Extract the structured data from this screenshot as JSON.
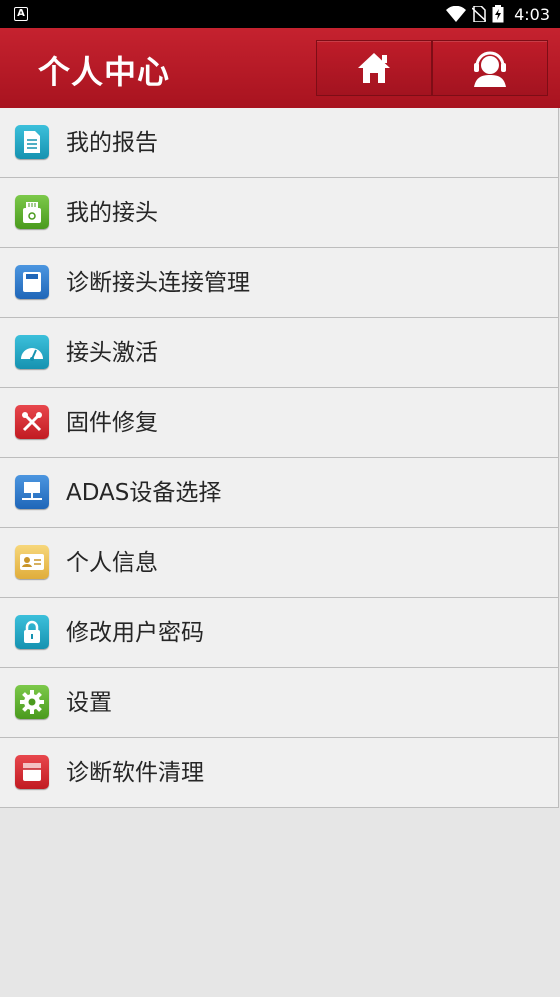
{
  "status_bar": {
    "time": "4:03",
    "app_icon_letter": "A"
  },
  "header": {
    "title": "个人中心"
  },
  "menu": [
    {
      "label": "我的报告",
      "color": "#1aa5c2"
    },
    {
      "label": "我的接头",
      "color": "#5bb12a"
    },
    {
      "label": "诊断接头连接管理",
      "color": "#2c7bd0"
    },
    {
      "label": "接头激活",
      "color": "#1aa5c2"
    },
    {
      "label": "固件修复",
      "color": "#d9262e"
    },
    {
      "label": "ADAS设备选择",
      "color": "#2c7bd0"
    },
    {
      "label": "个人信息",
      "color": "#f0c050"
    },
    {
      "label": "修改用户密码",
      "color": "#1aa5c2"
    },
    {
      "label": "设置",
      "color": "#5bb12a"
    },
    {
      "label": "诊断软件清理",
      "color": "#d9262e"
    }
  ]
}
